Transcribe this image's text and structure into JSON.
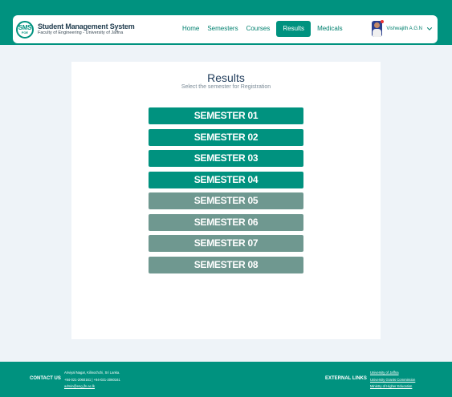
{
  "header": {
    "logo_text": "SMS",
    "logo_sub": "FOE",
    "title": "Student Management System",
    "subtitle": "Faculty of Engineering - University of Jaffna",
    "nav": [
      {
        "label": "Home"
      },
      {
        "label": "Semesters"
      },
      {
        "label": "Courses"
      },
      {
        "label": "Results",
        "active": true
      },
      {
        "label": "Medicals"
      }
    ],
    "user_name": "Vishwajith A.G.N"
  },
  "main": {
    "title": "Results",
    "subtitle": "Select the semester for Registration",
    "semesters": [
      {
        "label": "SEMESTER 01",
        "enabled": true
      },
      {
        "label": "SEMESTER 02",
        "enabled": true
      },
      {
        "label": "SEMESTER 03",
        "enabled": true
      },
      {
        "label": "SEMESTER 04",
        "enabled": true
      },
      {
        "label": "SEMESTER 05",
        "enabled": false
      },
      {
        "label": "SEMESTER 06",
        "enabled": false
      },
      {
        "label": "SEMESTER 07",
        "enabled": false
      },
      {
        "label": "SEMESTER 08",
        "enabled": false
      }
    ]
  },
  "footer": {
    "contact_label": "CONTACT US",
    "address": "Ariviyal Nagar, Kilinochchi, Sri Lanka.",
    "phone": "+94-021-2060161 | +94-021-2060161",
    "email": "admin@eng.jfn.ac.lk",
    "external_label": "EXTERNAL LINKS",
    "links": [
      "University of Jaffna",
      "University Grants Commission",
      "Ministry of Higher Education"
    ]
  },
  "colors": {
    "primary": "#00927f",
    "disabled_button": "#6f9890",
    "background": "#eef3f8"
  }
}
